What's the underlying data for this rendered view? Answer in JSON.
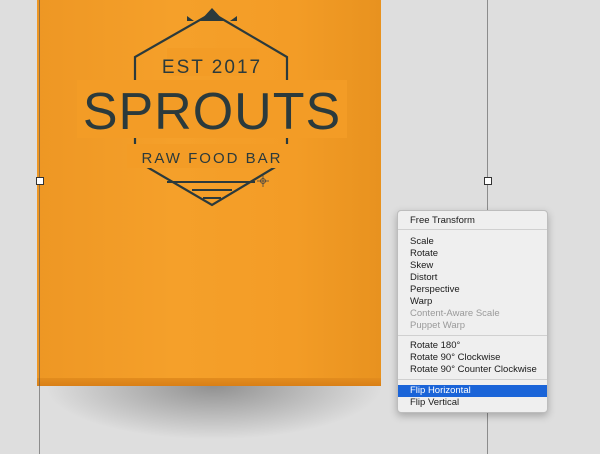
{
  "canvas": {
    "logo": {
      "est_line": "EST 2017",
      "brand": "SPROUTS",
      "tagline": "RAW FOOD BAR"
    }
  },
  "context_menu": {
    "items": [
      {
        "label": "Free Transform",
        "state": "normal"
      },
      {
        "label": "Scale",
        "state": "normal"
      },
      {
        "label": "Rotate",
        "state": "normal"
      },
      {
        "label": "Skew",
        "state": "normal"
      },
      {
        "label": "Distort",
        "state": "normal"
      },
      {
        "label": "Perspective",
        "state": "normal"
      },
      {
        "label": "Warp",
        "state": "normal"
      },
      {
        "label": "Content-Aware Scale",
        "state": "disabled"
      },
      {
        "label": "Puppet Warp",
        "state": "disabled"
      },
      {
        "label": "Rotate 180°",
        "state": "normal"
      },
      {
        "label": "Rotate 90° Clockwise",
        "state": "normal"
      },
      {
        "label": "Rotate 90° Counter Clockwise",
        "state": "normal"
      },
      {
        "label": "Flip Horizontal",
        "state": "selected"
      },
      {
        "label": "Flip Vertical",
        "state": "normal"
      }
    ]
  },
  "colors": {
    "box": "#f39c26",
    "logo_ink": "#2b3a3c",
    "selection": "#1a64d8"
  }
}
